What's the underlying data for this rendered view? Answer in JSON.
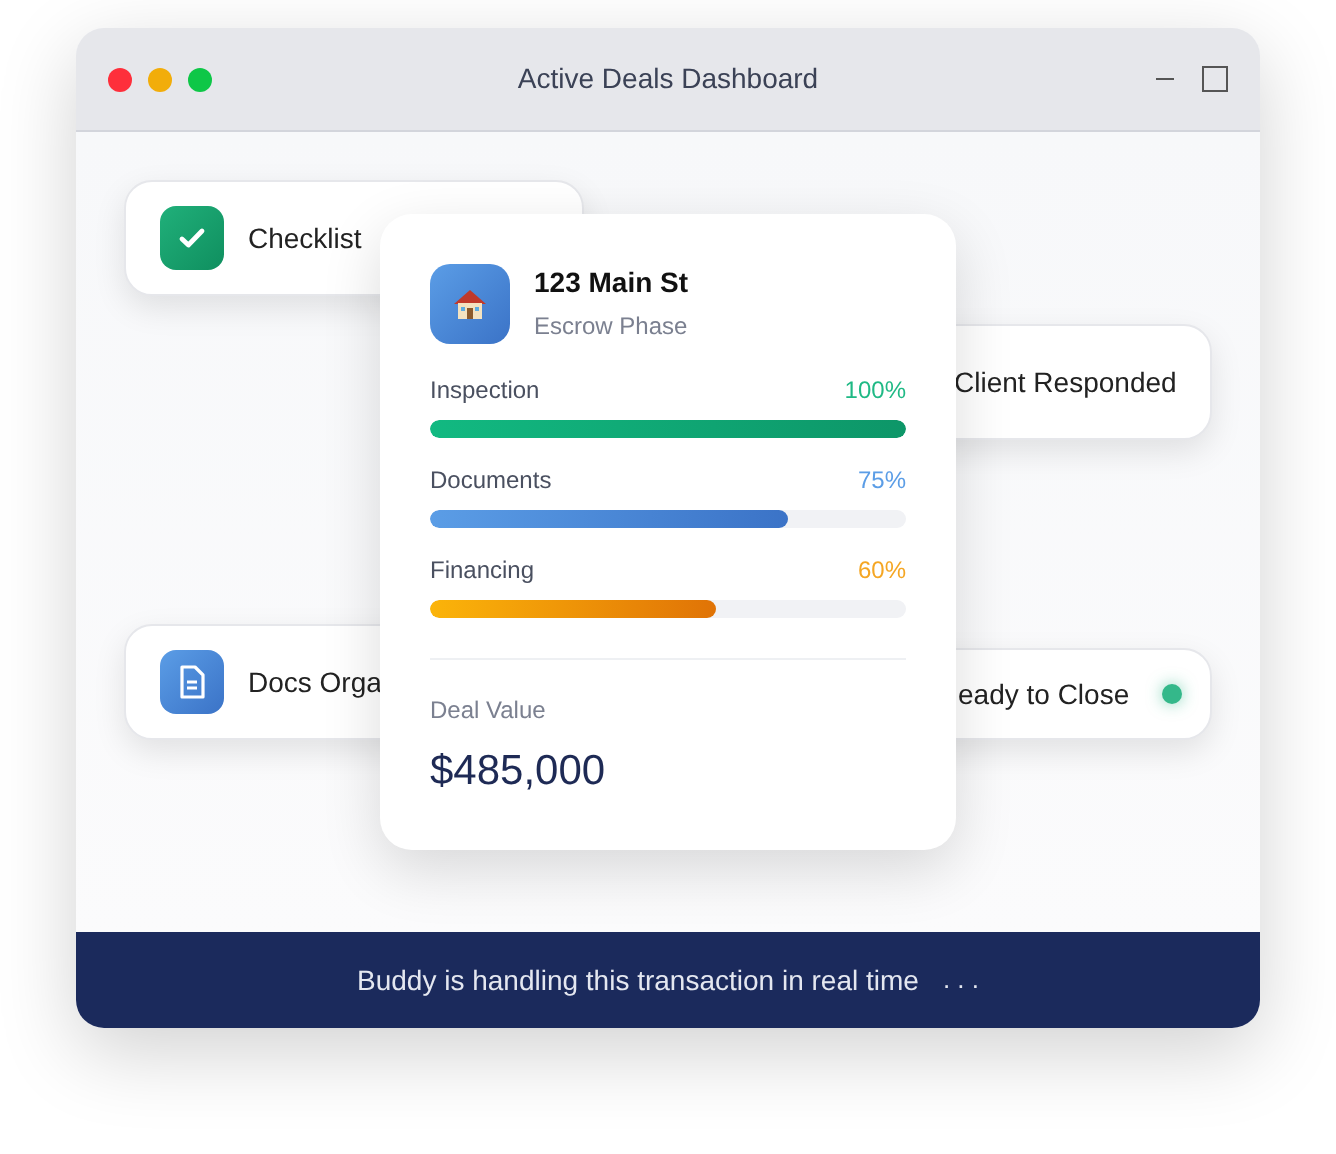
{
  "window": {
    "title": "Active Deals Dashboard"
  },
  "floating_cards": [
    {
      "kind": "check",
      "label": "Checklist"
    },
    {
      "kind": "plain",
      "label": "Client Responded"
    },
    {
      "kind": "doc",
      "label": "Docs Orga"
    },
    {
      "kind": "dot",
      "label": "eady to Close",
      "color": "#34b88a"
    }
  ],
  "deal": {
    "title": "123 Main St",
    "phase": "Escrow Phase",
    "progress": [
      {
        "name": "Inspection",
        "reading": "100%",
        "level": 1.0,
        "kind": "green"
      },
      {
        "name": "Documents",
        "reading": "75%",
        "level": 0.75,
        "kind": "blue"
      },
      {
        "name": "Financing",
        "reading": "60%",
        "level": 0.6,
        "kind": "orange"
      }
    ],
    "value_label": "Deal Value",
    "value": "$485,000"
  },
  "status_bar": {
    "text": "Buddy is handling this transaction in real time",
    "dots": ". . ."
  }
}
